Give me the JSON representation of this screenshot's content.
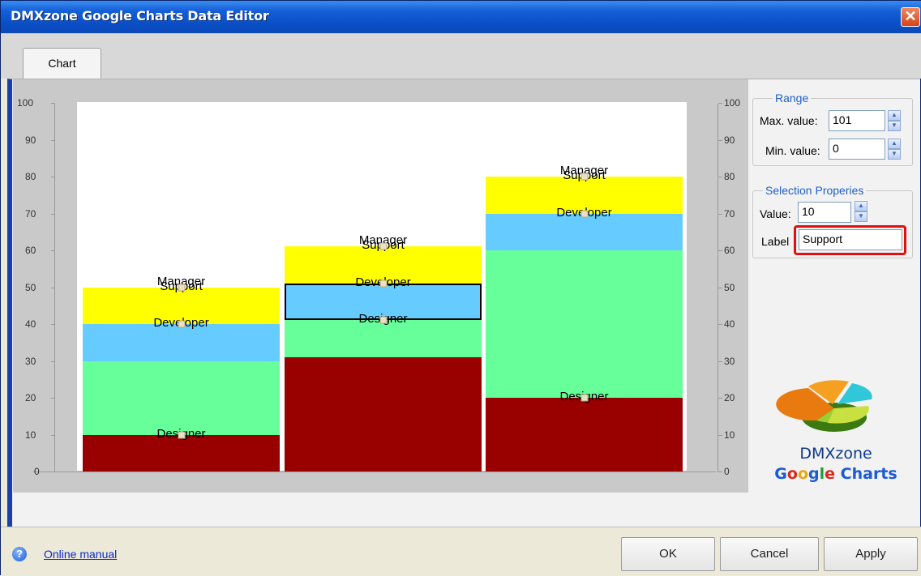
{
  "window": {
    "title": "DMXzone Google Charts Data Editor",
    "close_glyph": "✕"
  },
  "tabs": [
    {
      "label": "Chart",
      "active": true
    }
  ],
  "range": {
    "legend": "Range",
    "max_label": "Max. value:",
    "max_value": "101",
    "min_label": "Min. value:",
    "min_value": "0"
  },
  "selection": {
    "legend": "Selection Properies",
    "value_label": "Value:",
    "value": "10",
    "label_label": "Label",
    "label_value": "Support"
  },
  "logo": {
    "line1": "DMXzone",
    "google_letters": [
      "G",
      "o",
      "o",
      "g",
      "l",
      "e"
    ],
    "charts": "Charts"
  },
  "footer": {
    "help_glyph": "?",
    "manual_link": "Online manual",
    "ok": "OK",
    "cancel": "Cancel",
    "apply": "Apply"
  },
  "colors": {
    "designer": "#990000",
    "developer_green": "#66ff99",
    "developer": "#66ccff",
    "support": "#ffff00",
    "accent": "#1f5fc9",
    "highlight": "#e01010"
  },
  "chart_data": {
    "type": "bar",
    "stacked": true,
    "y_ticks": [
      "0",
      "10",
      "20",
      "30",
      "40",
      "50",
      "60",
      "70",
      "80",
      "90",
      "100"
    ],
    "ylim": [
      0,
      100
    ],
    "columns": [
      {
        "segments": [
          {
            "label": "Designer",
            "from": 0,
            "to": 10,
            "color": "#990000"
          },
          {
            "label": "",
            "from": 10,
            "to": 30,
            "color": "#66ff99"
          },
          {
            "label": "Developer",
            "from": 30,
            "to": 40,
            "color": "#66ccff"
          },
          {
            "label": "Support",
            "from": 40,
            "to": 50,
            "color": "#ffff00"
          }
        ],
        "top_label": "Manager",
        "top_value": 50
      },
      {
        "segments": [
          {
            "label": "",
            "from": 0,
            "to": 31,
            "color": "#990000"
          },
          {
            "label": "Designer",
            "from": 31,
            "to": 41,
            "color": "#66ff99"
          },
          {
            "label": "Developer",
            "from": 41,
            "to": 51,
            "color": "#66ccff",
            "selected": true
          },
          {
            "label": "Support",
            "from": 51,
            "to": 61,
            "color": "#ffff00"
          }
        ],
        "top_label": "Manager",
        "top_value": 61
      },
      {
        "segments": [
          {
            "label": "Designer",
            "from": 0,
            "to": 20,
            "color": "#990000"
          },
          {
            "label": "",
            "from": 20,
            "to": 60,
            "color": "#66ff99"
          },
          {
            "label": "Developer",
            "from": 60,
            "to": 70,
            "color": "#66ccff"
          },
          {
            "label": "Support",
            "from": 70,
            "to": 80,
            "color": "#ffff00"
          }
        ],
        "top_label": "Manager",
        "top_value": 80
      }
    ]
  }
}
